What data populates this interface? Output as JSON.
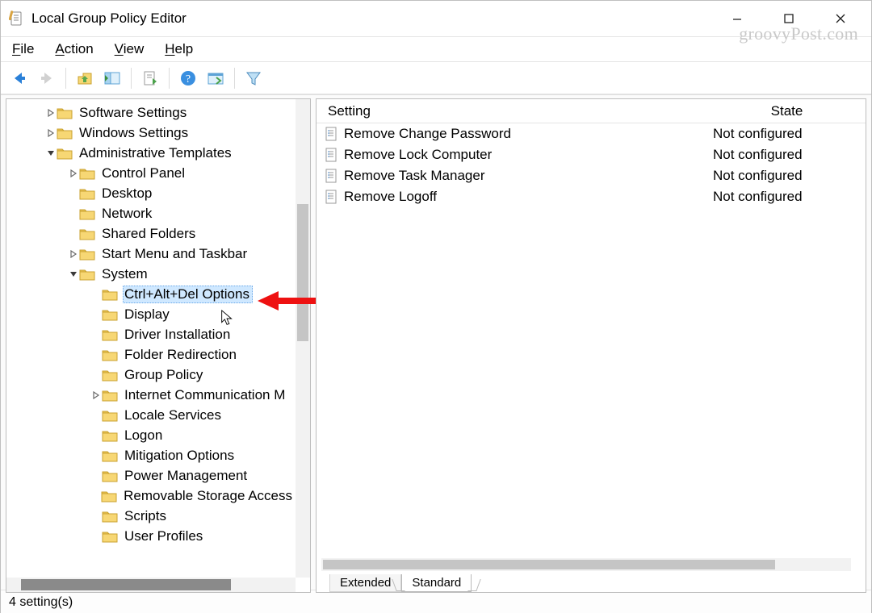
{
  "window": {
    "title": "Local Group Policy Editor",
    "watermark": "groovyPost.com"
  },
  "menu": {
    "file": "File",
    "action": "Action",
    "view": "View",
    "help": "Help"
  },
  "tree": {
    "items": [
      {
        "depth": 1,
        "tw": "right",
        "label": "Software Settings"
      },
      {
        "depth": 1,
        "tw": "right",
        "label": "Windows Settings"
      },
      {
        "depth": 1,
        "tw": "down",
        "label": "Administrative Templates"
      },
      {
        "depth": 2,
        "tw": "right",
        "label": "Control Panel"
      },
      {
        "depth": 2,
        "tw": "none",
        "label": "Desktop"
      },
      {
        "depth": 2,
        "tw": "none",
        "label": "Network"
      },
      {
        "depth": 2,
        "tw": "none",
        "label": "Shared Folders"
      },
      {
        "depth": 2,
        "tw": "right",
        "label": "Start Menu and Taskbar"
      },
      {
        "depth": 2,
        "tw": "down",
        "label": "System"
      },
      {
        "depth": 3,
        "tw": "none",
        "label": "Ctrl+Alt+Del Options",
        "selected": true
      },
      {
        "depth": 3,
        "tw": "none",
        "label": "Display"
      },
      {
        "depth": 3,
        "tw": "none",
        "label": "Driver Installation"
      },
      {
        "depth": 3,
        "tw": "none",
        "label": "Folder Redirection"
      },
      {
        "depth": 3,
        "tw": "none",
        "label": "Group Policy"
      },
      {
        "depth": 3,
        "tw": "right",
        "label": "Internet Communication M"
      },
      {
        "depth": 3,
        "tw": "none",
        "label": "Locale Services"
      },
      {
        "depth": 3,
        "tw": "none",
        "label": "Logon"
      },
      {
        "depth": 3,
        "tw": "none",
        "label": "Mitigation Options"
      },
      {
        "depth": 3,
        "tw": "none",
        "label": "Power Management"
      },
      {
        "depth": 3,
        "tw": "none",
        "label": "Removable Storage Access"
      },
      {
        "depth": 3,
        "tw": "none",
        "label": "Scripts"
      },
      {
        "depth": 3,
        "tw": "none",
        "label": "User Profiles"
      }
    ]
  },
  "list": {
    "columns": {
      "setting": "Setting",
      "state": "State"
    },
    "rows": [
      {
        "setting": "Remove Change Password",
        "state": "Not configured"
      },
      {
        "setting": "Remove Lock Computer",
        "state": "Not configured"
      },
      {
        "setting": "Remove Task Manager",
        "state": "Not configured"
      },
      {
        "setting": "Remove Logoff",
        "state": "Not configured"
      }
    ]
  },
  "tabs": {
    "extended": "Extended",
    "standard": "Standard"
  },
  "status": {
    "text": "4 setting(s)"
  }
}
